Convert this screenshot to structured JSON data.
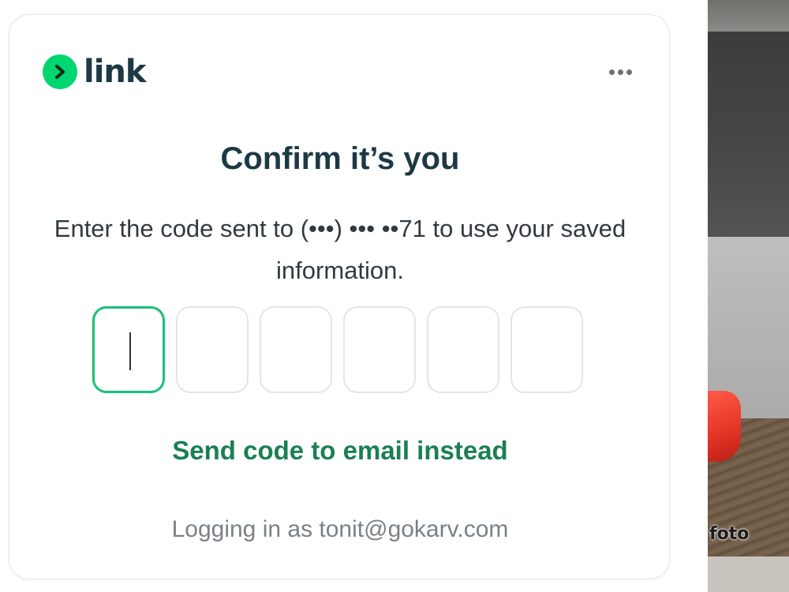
{
  "brand": {
    "name": "link",
    "icon": "chevron-right-icon",
    "accent_color": "#00d66f",
    "text_color": "#1d3944"
  },
  "menu": {
    "icon": "more-horizontal-icon"
  },
  "dialog": {
    "title": "Confirm it’s you",
    "subtitle": "Enter the code sent to (•••) ••• ••71 to use your saved information.",
    "code_length": 6,
    "code_values": [
      "",
      "",
      "",
      "",
      "",
      ""
    ],
    "active_index": 0,
    "alt_action_label": "Send code to email instead",
    "footer_text": "Logging in as tonit@gokarv.com"
  },
  "background_photo": {
    "caption": "foto"
  },
  "colors": {
    "focus_border": "#1fbf7a",
    "link_green": "#1a7f52",
    "muted_text": "#7a8186"
  }
}
